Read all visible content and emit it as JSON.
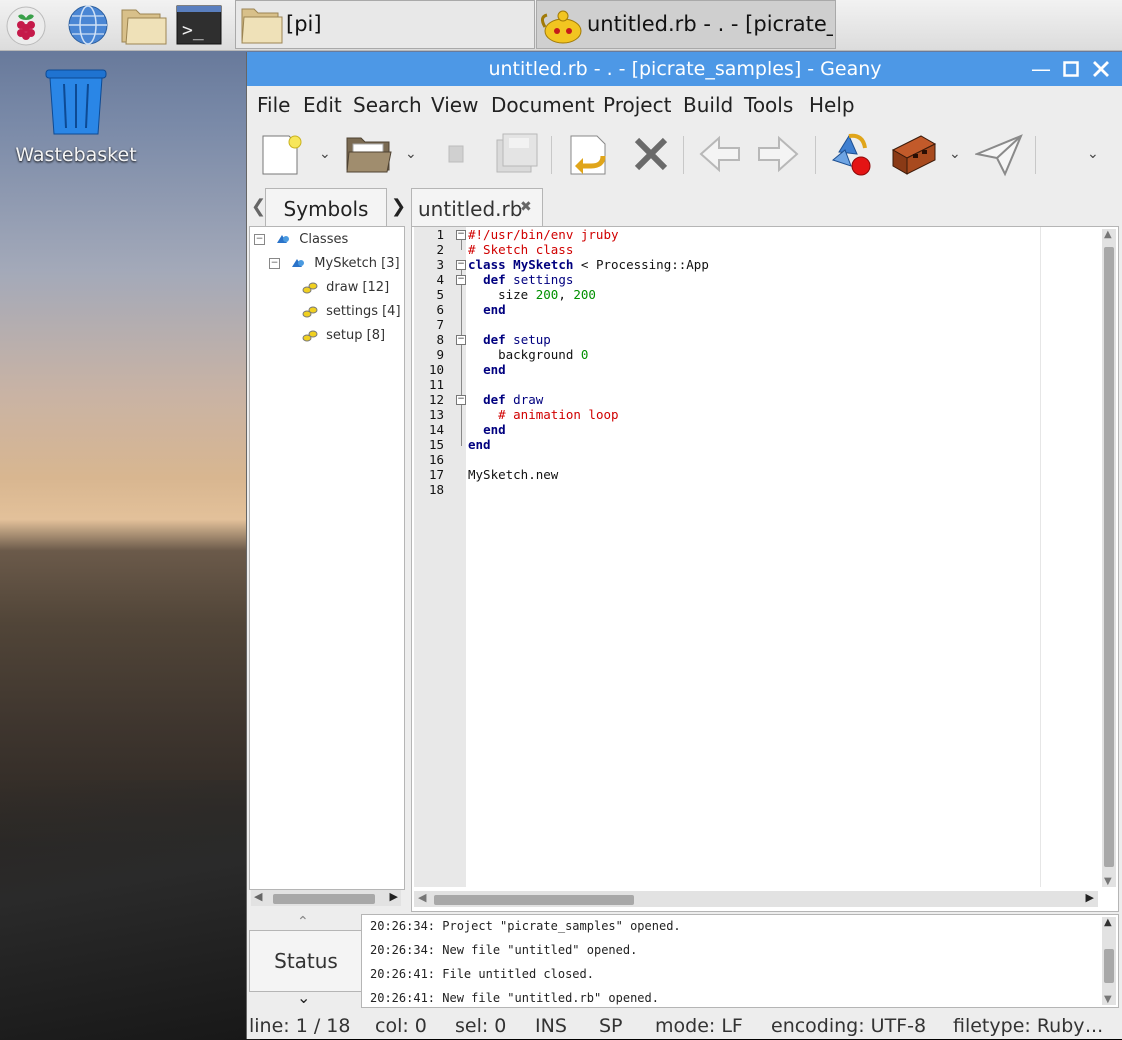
{
  "taskbar": {
    "tasks": [
      {
        "label": "[pi]"
      },
      {
        "label": "untitled.rb - . - [picrate_sa..."
      }
    ]
  },
  "desktop": {
    "icons": [
      {
        "label": "Wastebasket"
      }
    ]
  },
  "window": {
    "title": "untitled.rb - . - [picrate_samples] - Geany",
    "menu": [
      "File",
      "Edit",
      "Search",
      "View",
      "Document",
      "Project",
      "Build",
      "Tools",
      "Help"
    ]
  },
  "sidebar": {
    "tab_label": "Symbols",
    "tree": [
      {
        "label": "Classes"
      },
      {
        "label": "MySketch [3]"
      },
      {
        "label": "draw [12]"
      },
      {
        "label": "settings [4]"
      },
      {
        "label": "setup [8]"
      }
    ]
  },
  "editor": {
    "tab_label": "untitled.rb",
    "line_numbers": [
      "1",
      "2",
      "3",
      "4",
      "5",
      "6",
      "7",
      "8",
      "9",
      "10",
      "11",
      "12",
      "13",
      "14",
      "15",
      "16",
      "17",
      "18"
    ],
    "lines": [
      {
        "parts": [
          {
            "t": "#!/usr/bin/env jruby",
            "c": "cm"
          }
        ]
      },
      {
        "parts": [
          {
            "t": "# Sketch class",
            "c": "cm"
          }
        ]
      },
      {
        "parts": [
          {
            "t": "class",
            "c": "kw"
          },
          {
            "t": " "
          },
          {
            "t": "MySketch",
            "c": "cls"
          },
          {
            "t": " < Processing::App"
          }
        ]
      },
      {
        "parts": [
          {
            "t": "  "
          },
          {
            "t": "def",
            "c": "kw"
          },
          {
            "t": " "
          },
          {
            "t": "settings",
            "c": "fn"
          }
        ]
      },
      {
        "parts": [
          {
            "t": "    size "
          },
          {
            "t": "200",
            "c": "num"
          },
          {
            "t": ", "
          },
          {
            "t": "200",
            "c": "num"
          }
        ]
      },
      {
        "parts": [
          {
            "t": "  "
          },
          {
            "t": "end",
            "c": "kw"
          }
        ]
      },
      {
        "parts": []
      },
      {
        "parts": [
          {
            "t": "  "
          },
          {
            "t": "def",
            "c": "kw"
          },
          {
            "t": " "
          },
          {
            "t": "setup",
            "c": "fn"
          }
        ]
      },
      {
        "parts": [
          {
            "t": "    background "
          },
          {
            "t": "0",
            "c": "num"
          }
        ]
      },
      {
        "parts": [
          {
            "t": "  "
          },
          {
            "t": "end",
            "c": "kw"
          }
        ]
      },
      {
        "parts": []
      },
      {
        "parts": [
          {
            "t": "  "
          },
          {
            "t": "def",
            "c": "kw"
          },
          {
            "t": " "
          },
          {
            "t": "draw",
            "c": "fn"
          }
        ]
      },
      {
        "parts": [
          {
            "t": "    "
          },
          {
            "t": "# animation loop",
            "c": "cm"
          }
        ]
      },
      {
        "parts": [
          {
            "t": "  "
          },
          {
            "t": "end",
            "c": "kw"
          }
        ]
      },
      {
        "parts": [
          {
            "t": "end",
            "c": "kw"
          }
        ]
      },
      {
        "parts": []
      },
      {
        "parts": [
          {
            "t": "MySketch.new"
          }
        ]
      },
      {
        "parts": []
      }
    ]
  },
  "messages": {
    "tab_label": "Status",
    "lines": [
      "20:26:34: Project \"picrate_samples\" opened.",
      "20:26:34: New file \"untitled\" opened.",
      "20:26:41: File untitled closed.",
      "20:26:41: New file \"untitled.rb\" opened."
    ]
  },
  "statusbar": {
    "line": "line: 1 / 18",
    "col": "col: 0",
    "sel": "sel: 0",
    "ins": "INS",
    "sp": "SP",
    "mode": "mode: LF",
    "encoding": "encoding: UTF-8",
    "filetype": "filetype: Ruby",
    "more": "..."
  },
  "colors": {
    "titlebar": "#4d98e6",
    "keyword": "#00007f",
    "comment": "#d00000",
    "number": "#009000"
  }
}
